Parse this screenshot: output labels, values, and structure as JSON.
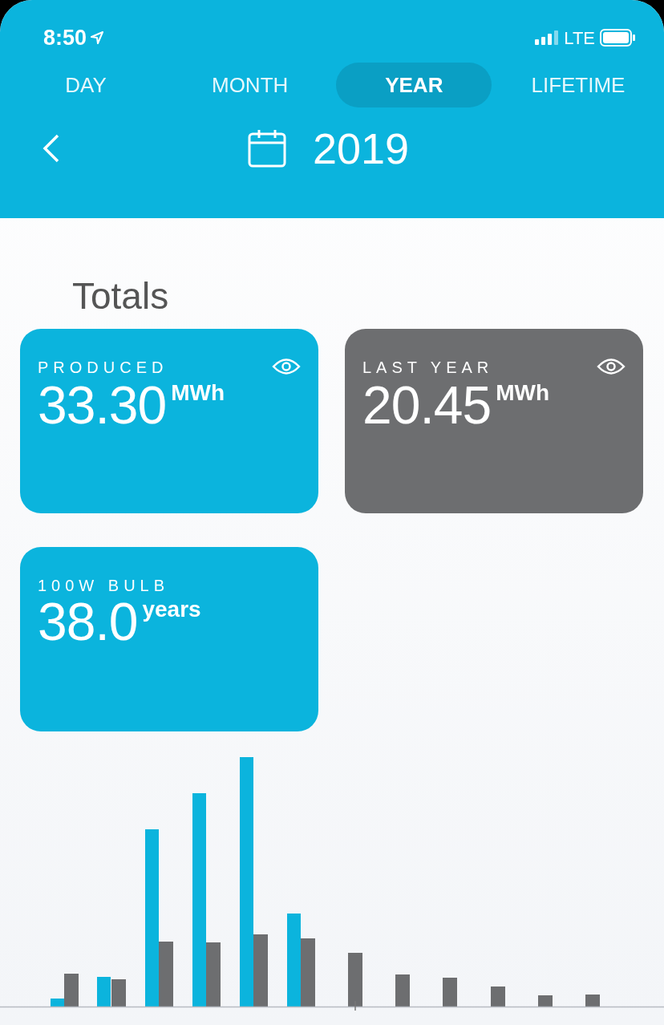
{
  "status_bar": {
    "time": "8:50",
    "network": "LTE"
  },
  "tabs": [
    {
      "label": "DAY",
      "selected": false
    },
    {
      "label": "MONTH",
      "selected": false
    },
    {
      "label": "YEAR",
      "selected": true
    },
    {
      "label": "LIFETIME",
      "selected": false
    }
  ],
  "period": {
    "label": "2019"
  },
  "section_title": "Totals",
  "cards": [
    {
      "label": "PRODUCED",
      "value": "33.30",
      "unit": "MWh",
      "color": "#0bb4dd",
      "eye": true
    },
    {
      "label": "LAST YEAR",
      "value": "20.45",
      "unit": "MWh",
      "color": "#6d6e70",
      "eye": true
    },
    {
      "label": "100W BULB",
      "value": "38.0",
      "unit": "years",
      "color": "#0bb4dd",
      "eye": false
    }
  ]
}
